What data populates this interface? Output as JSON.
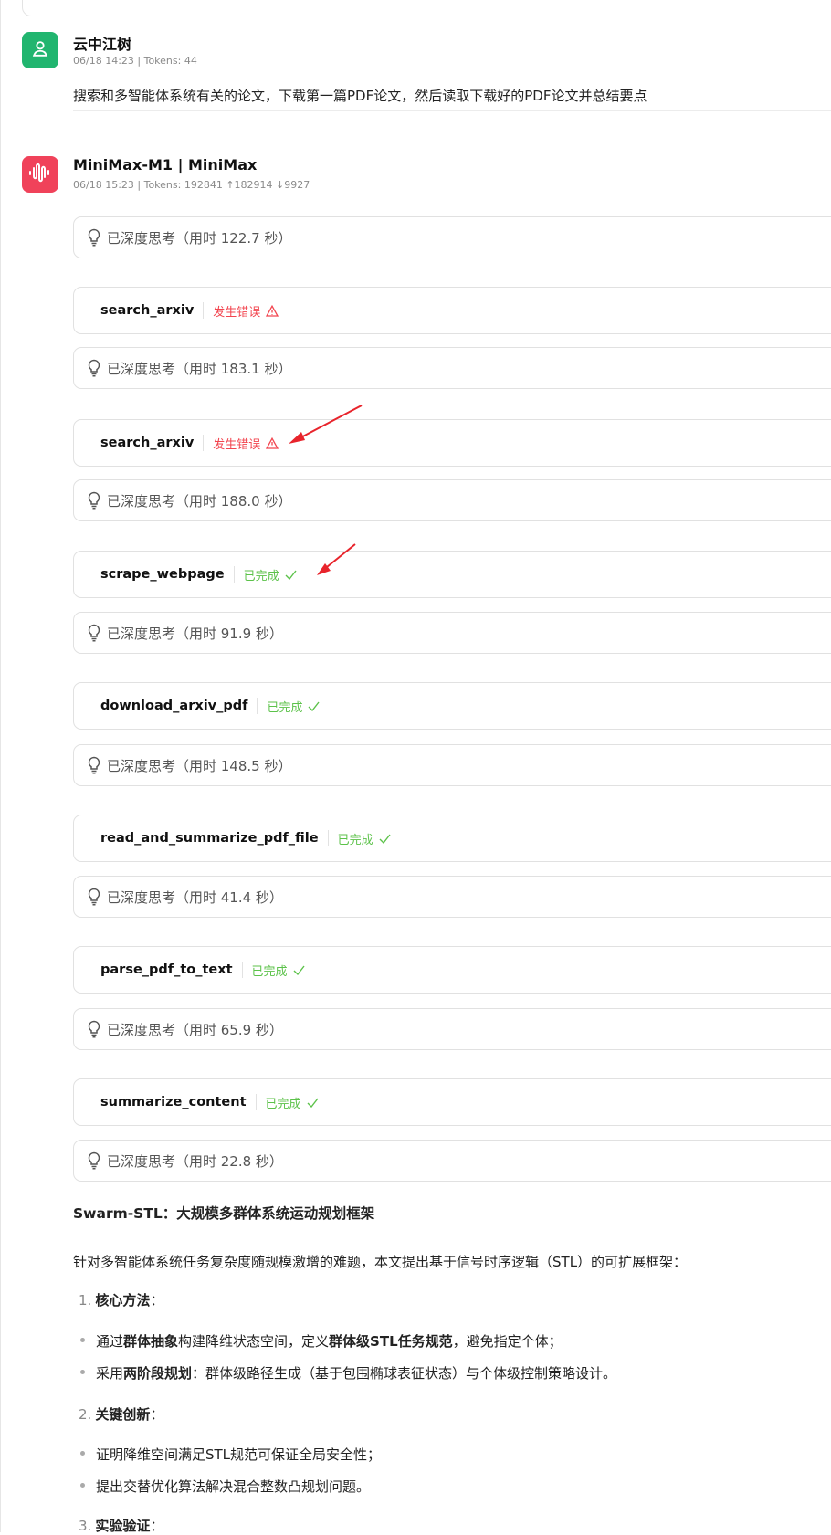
{
  "user_message": {
    "name": "云中江树",
    "meta": "06/18 14:23  |  Tokens: 44",
    "text": "搜索和多智能体系统有关的论文，下载第一篇PDF论文，然后读取下载好的PDF论文并总结要点"
  },
  "bot_message": {
    "name": "MiniMax-M1 | MiniMax",
    "meta": "06/18 15:23  |  Tokens: 192841  ↑182914  ↓9927"
  },
  "steps": [
    {
      "kind": "think",
      "label": "已深度思考（用时 122.7 秒）"
    },
    {
      "kind": "tool",
      "name": "search_arxiv",
      "status": "发生错误",
      "state": "error"
    },
    {
      "kind": "think",
      "label": "已深度思考（用时 183.1 秒）"
    },
    {
      "kind": "tool",
      "name": "search_arxiv",
      "status": "发生错误",
      "state": "error"
    },
    {
      "kind": "think",
      "label": "已深度思考（用时 188.0 秒）"
    },
    {
      "kind": "tool",
      "name": "scrape_webpage",
      "status": "已完成",
      "state": "ok"
    },
    {
      "kind": "think",
      "label": "已深度思考（用时 91.9 秒）"
    },
    {
      "kind": "tool",
      "name": "download_arxiv_pdf",
      "status": "已完成",
      "state": "ok"
    },
    {
      "kind": "think",
      "label": "已深度思考（用时 148.5 秒）"
    },
    {
      "kind": "tool",
      "name": "read_and_summarize_pdf_file",
      "status": "已完成",
      "state": "ok"
    },
    {
      "kind": "think",
      "label": "已深度思考（用时 41.4 秒）"
    },
    {
      "kind": "tool",
      "name": "parse_pdf_to_text",
      "status": "已完成",
      "state": "ok"
    },
    {
      "kind": "think",
      "label": "已深度思考（用时 65.9 秒）"
    },
    {
      "kind": "tool",
      "name": "summarize_content",
      "status": "已完成",
      "state": "ok"
    },
    {
      "kind": "think",
      "label": "已深度思考（用时 22.8 秒）"
    }
  ],
  "answer": {
    "title": "Swarm-STL：大规模多群体系统运动规划框架",
    "intro": "针对多智能体系统任务复杂度随规模激增的难题，本文提出基于信号时序逻辑（STL）的可扩展框架：",
    "sections": [
      {
        "num": "1.",
        "head": "核心方法",
        "colon": "：",
        "bullets": [
          {
            "parts": [
              "通过",
              "群体抽象",
              "构建降维状态空间，定义",
              "群体级STL任务规范",
              "，避免指定个体；"
            ]
          },
          {
            "parts": [
              "采用",
              "两阶段规划",
              "：群体级路径生成（基于包围椭球表征状态）与个体级控制策略设计。"
            ]
          }
        ]
      },
      {
        "num": "2.",
        "head": "关键创新",
        "colon": "：",
        "bullets": [
          {
            "parts": [
              "证明降维空间满足STL规范可保证全局安全性；"
            ]
          },
          {
            "parts": [
              "提出交替优化算法解决混合整数凸规划问题。"
            ]
          }
        ]
      },
      {
        "num": "3.",
        "head": "实验验证",
        "colon": "："
      }
    ]
  },
  "colors": {
    "error": "#f2454f",
    "ok": "#5cc24a",
    "user_avatar": "#21b56f",
    "bot_avatar": "#f0425a",
    "annotation_arrow": "#e8242c"
  },
  "icons": {
    "user_avatar": "person-icon",
    "bot_avatar": "waveform-icon",
    "think": "lightbulb-icon",
    "error": "warning-triangle-icon",
    "ok": "checkmark-icon"
  }
}
